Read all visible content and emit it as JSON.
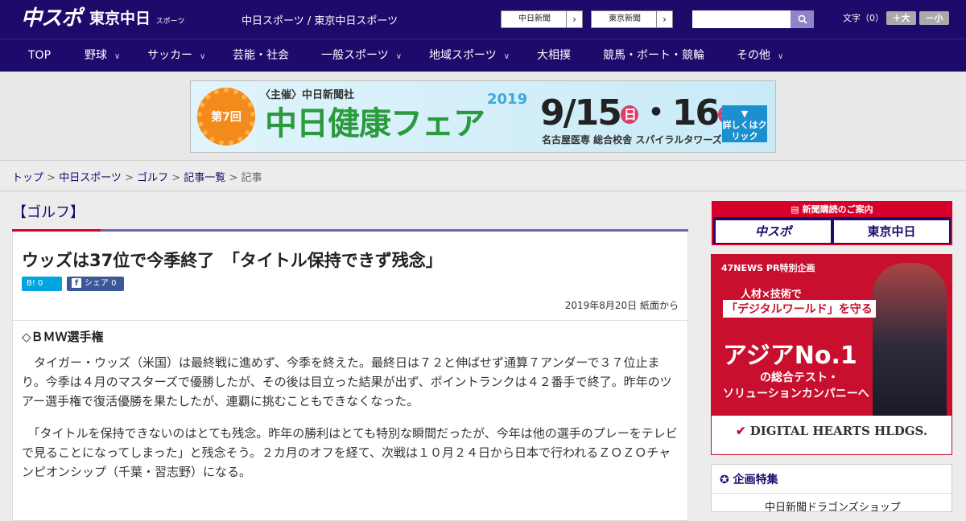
{
  "header": {
    "logo_chuspo": "中スポ",
    "logo_tokyo": "東京中日",
    "logo_tokyo_small": "スポーツ",
    "site_title": "中日スポーツ / 東京中日スポーツ",
    "link1": "中日新聞",
    "link2": "東京新聞",
    "search_placeholder": "",
    "font_size_label": "文字（0）",
    "font_up": "＋大",
    "font_down": "－小"
  },
  "nav": {
    "items": [
      "TOP",
      "野球",
      "サッカー",
      "芸能・社会",
      "一般スポーツ",
      "地域スポーツ",
      "大相撲",
      "競馬・ボート・競輪",
      "その他"
    ]
  },
  "banner": {
    "round": "第7回",
    "organizer": "〈主催〉中日新聞社",
    "title": "中日健康フェア",
    "year": "2019",
    "dates": "9/15",
    "day1": "日",
    "dates2": "・16",
    "day2": "祝",
    "venue": "名古屋医専 総合校舎 スパイラルタワーズ",
    "cta": "詳しくはクリック"
  },
  "breadcrumb": {
    "top": "トップ",
    "sep": " > ",
    "chunichi": "中日スポーツ",
    "golf": "ゴルフ",
    "list": "記事一覧",
    "current": "記事"
  },
  "article": {
    "category": "【ゴルフ】",
    "headline": "ウッズは37位で今季終了　「タイトル保持できず残念」",
    "hatena": "B! 0",
    "fb_share": "シェア 0",
    "dateline": "2019年8月20日 紙面から",
    "subhead": "◇ＢＭＷ選手権",
    "para1": "　タイガー・ウッズ（米国）は最終戦に進めず、今季を終えた。最終日は７２と伸ばせず通算７アンダーで３７位止まり。今季は４月のマスターズで優勝したが、その後は目立った結果が出ず、ポイントランクは４２番手で終了。昨年のツアー選手権で復活優勝を果たしたが、連覇に挑むこともできなくなった。",
    "para2": "　「タイトルを保持できないのはとても残念。昨年の勝利はとても特別な瞬間だったが、今年は他の選手のプレーをテレビで見ることになってしまった」と残念そう。２カ月のオフを経て、次戦は１０月２４日から日本で行われるＺＯＺＯチャンピオンシップ（千葉・習志野）になる。"
  },
  "sidebar": {
    "subscribe_title": "新聞購読のご案内",
    "subscribe_a": "中スポ",
    "subscribe_b": "東京中日",
    "ad_label": "47NEWS PR特別企画",
    "ad_line1": "人材×技術で",
    "ad_line2": "「デジタルワールド」を守る",
    "ad_line3": "アジアNo.1",
    "ad_line4": "の総合テスト・",
    "ad_line5": "ソリューションカンパニーへ",
    "ad_brand": "DIGITAL HEARTS HLDGS.",
    "feature_title": "企画特集",
    "feature_item": "中日新聞ドラゴンズショップ"
  }
}
